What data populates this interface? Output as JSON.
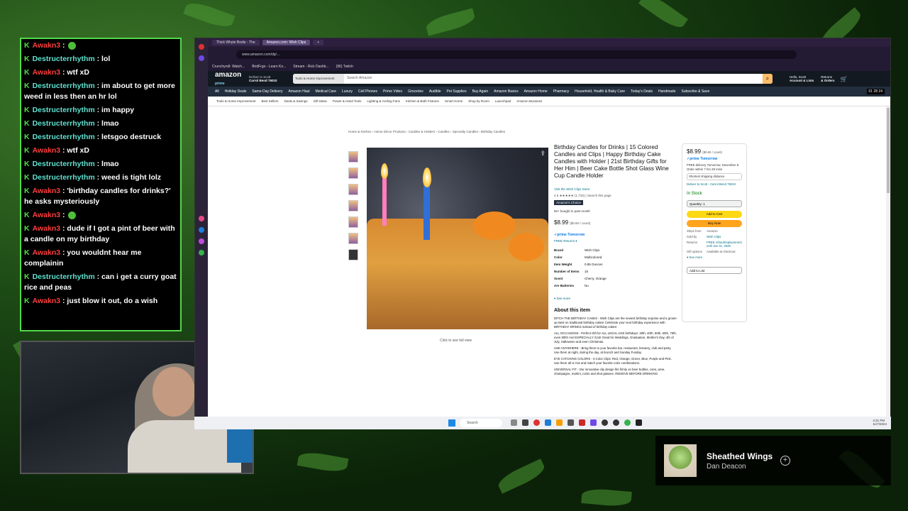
{
  "chat": {
    "messages": [
      {
        "user": "Awakn3",
        "text": ":",
        "emote": true
      },
      {
        "user": "Destructerrhythm",
        "text": ": lol"
      },
      {
        "user": "Awakn3",
        "text": ": wtf xD"
      },
      {
        "user": "Destructerrhythm",
        "text": ": im about to get more weed in less then an hr lol"
      },
      {
        "user": "Destructerrhythm",
        "text": ": im happy"
      },
      {
        "user": "Destructerrhythm",
        "text": ": lmao"
      },
      {
        "user": "Destructerrhythm",
        "text": ": letsgoo destruck"
      },
      {
        "user": "Awakn3",
        "text": ": wtf xD"
      },
      {
        "user": "Destructerrhythm",
        "text": ": lmao"
      },
      {
        "user": "Destructerrhythm",
        "text": ": weed is tight lolz"
      },
      {
        "user": "Awakn3",
        "text": ": 'birthday candles for drinks?' he asks mysteriously"
      },
      {
        "user": "Awakn3",
        "text": ":",
        "emote": true
      },
      {
        "user": "Awakn3",
        "text": ": dude if I got a pint of beer with a candle on my birthday"
      },
      {
        "user": "Awakn3",
        "text": ": you wouldnt hear me complainin"
      },
      {
        "user": "Destructerrhythm",
        "text": ": can i get a curry goat rice and peas"
      },
      {
        "user": "Awakn3",
        "text": ": just blow it out, do a wish"
      }
    ]
  },
  "browser": {
    "tabs": [
      "Thick Whyte Bodie - The",
      "Amazon.com: Wish Clips"
    ],
    "url": "www.amazon.com/dp/...",
    "bookmarks": [
      "Crunchyroll: Watch...",
      "BirdFrgo - Learn Ko...",
      "Stream - Rick Dashb...",
      "(96) Twitch"
    ]
  },
  "amazon": {
    "logo": "amazon",
    "prime": "prime",
    "deliver_to": "Deliver to Scott",
    "deliver_city": "Carrol Bend 75010",
    "search_category": "Tools & Home Improvement",
    "search_placeholder": "Search Amazon",
    "account": "Hello, Scott",
    "account_sub": "Account & Lists",
    "returns": "Returns",
    "orders": "& Orders",
    "nav": [
      "All",
      "Holiday Deals",
      "Same-Day Delivery",
      "Amazon Haul",
      "Medical Care",
      "Luxury",
      "Cell Phones",
      "Prime Video",
      "Groceries",
      "Audible",
      "Pet Supplies",
      "Buy Again",
      "Amazon Basics",
      "Amazon Home",
      "Pharmacy",
      "Household, Health & Baby Care",
      "Today's Deals",
      "Handmade",
      "Subscribe & Save"
    ],
    "countdown": "01 28 24",
    "subnav": [
      "Tools & Home Improvement",
      "Best Sellers",
      "Deals & Savings",
      "Gift Ideas",
      "Power & Hand Tools",
      "Lighting & Ceiling Fans",
      "Kitchen & Bath Fixtures",
      "Smart Home",
      "Shop by Room",
      "Launchpad",
      "Amazon Business"
    ],
    "breadcrumb": "Home & Kitchen › Home Décor Products › Candles & Holders › Candles › Specialty Candles › Birthday Candles",
    "click_full": "Click to see full view",
    "product": {
      "title": "Birthday Candles for Drinks | 15 Colored Candles and Clips | Happy Birthday Cake Candles with Holder | 21st Birthday Gifts for Her Him | Beer Cake Bottle Shot Glass Wine Cup Candle Holder",
      "store": "Visit the Wish Clips Store",
      "rating": "4.5 ★★★★★ (1,733)  |  Search this page",
      "choice": "Amazon's Choice",
      "bought": "50+ bought in past month",
      "price": "$8.99",
      "price_unit": "($0.60 / count)",
      "prime": "✓prime Tomorrow",
      "returns": "FREE Returns ▾",
      "specs": [
        {
          "label": "Brand",
          "value": "Wish Clips"
        },
        {
          "label": "Color",
          "value": "Multicolored"
        },
        {
          "label": "Item Weight",
          "value": "0.85 Ounces"
        },
        {
          "label": "Number of Items",
          "value": "15"
        },
        {
          "label": "Scent",
          "value": "Cherry, Orange"
        },
        {
          "label": "Are Batteries",
          "value": "No"
        }
      ],
      "see_more": "▾ See more",
      "about_title": "About this item",
      "bullets": [
        "DITCH THE BIRTHDAY CAKES - Wish Clips are the newest birthday surprise and a grown-up twist on traditional birthday cakes! Celebrate your next birthday experience with BIRTHDAY DRINKS instead of birthday cakes!",
        "ALL OCCASIONS - Perfect Gift for ALL LEGAL AGE birthdays: 30th, 40th, 50th, 60th, 70th, even 80th! And ESPECIALLY 21st! Great for Weddings, Graduation, Mother's Day, 4th of July, Halloween and even Christmas.",
        "USE ANYWHERE - Bring them to your favorite bar, restaurant, brewery, club and party. Use them at night, during the day, at brunch and Sunday Funday.",
        "EYE CATCHING COLORS - 6 Color Clips: Red, Orange, Green, Blue, Purple and Pink. Use them all or mix and match your favorite color combinations.",
        "UNIVERSAL FIT - Our innovative clip design fits firmly on beer bottles, cans, wine, champagne, martini, rocks and shot glasses. REMOVE BEFORE DRINKING."
      ]
    },
    "buybox": {
      "price": "$8.99",
      "price_unit": "($0.60 / count)",
      "prime": "✓prime Tomorrow",
      "delivery": "FREE delivery Tomorrow, November 8. Order within 7 hrs 29 mins",
      "shortest": "Shortest shipping distance",
      "deliver_to": "Deliver to Scott - Carrol Bend 75010",
      "stock": "In Stock",
      "qty": "Quantity: 1",
      "add_cart": "Add to Cart",
      "buy_now": "Buy Now",
      "ships_from_label": "Ships from",
      "ships_from": "Amazon",
      "sold_by_label": "Sold by",
      "sold_by": "Wish Clips",
      "returns_label": "Returns",
      "returns": "FREE refund/replacement until Jan 31, 2025",
      "gift_label": "Gift options",
      "gift": "Available at checkout",
      "see_more": "▾ See more",
      "add_list": "Add to List"
    }
  },
  "taskbar": {
    "search": "Search",
    "time": "4:31 PM",
    "date": "11/7/2024"
  },
  "music": {
    "song": "Sheathed Wings",
    "artist": "Dan Deacon"
  },
  "colors": {
    "chat_border": "#53d94a",
    "user_green": "#5fe0cf",
    "user_red": "#ff3d3d",
    "amazon_dark": "#131921",
    "amazon_nav": "#232f3e"
  }
}
